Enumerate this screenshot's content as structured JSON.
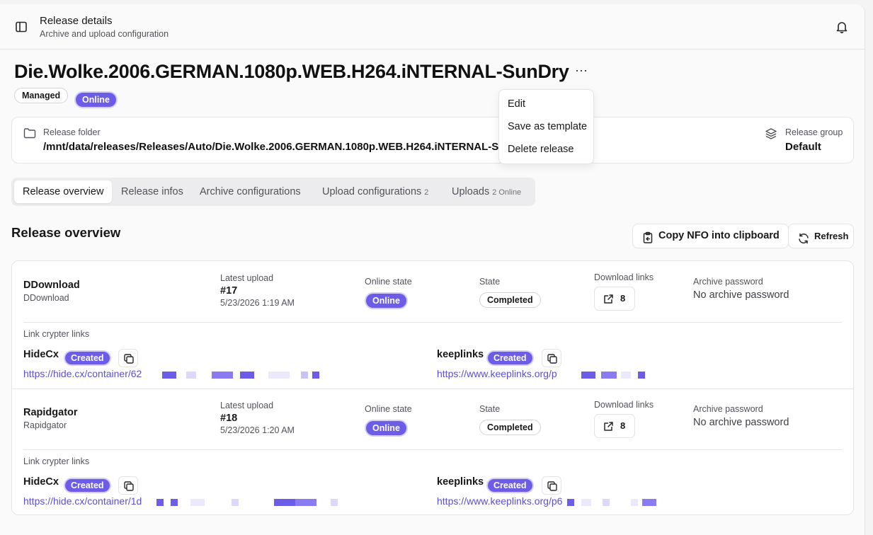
{
  "header": {
    "title": "Release details",
    "subtitle": "Archive and upload configuration"
  },
  "release": {
    "name": "Die.Wolke.2006.GERMAN.1080p.WEB.H264.iNTERNAL-SunDry",
    "badges": {
      "managed": "Managed",
      "online": "Online"
    },
    "folder_label": "Release folder",
    "folder_path": "/mnt/data/releases/Releases/Auto/Die.Wolke.2006.GERMAN.1080p.WEB.H264.iNTERNAL-SunDry",
    "group_label": "Release group",
    "group_value": "Default",
    "more_label": "···"
  },
  "menu": {
    "edit": "Edit",
    "save_template": "Save as template",
    "delete": "Delete release"
  },
  "tabs": [
    {
      "label": "Release overview",
      "count": ""
    },
    {
      "label": "Release infos",
      "count": ""
    },
    {
      "label": "Archive configurations",
      "count": ""
    },
    {
      "label": "Upload configurations",
      "count": "2"
    },
    {
      "label": "Uploads",
      "count": "2 Online"
    }
  ],
  "overview": {
    "title": "Release overview",
    "copy_nfo": "Copy NFO into clipboard",
    "refresh": "Refresh"
  },
  "columns": {
    "latest_upload": "Latest upload",
    "online_state": "Online state",
    "state": "State",
    "download_links": "Download links",
    "archive_password": "Archive password",
    "link_crypter": "Link crypter links"
  },
  "uploads": [
    {
      "hoster": "DDownload",
      "hoster_sub": "DDownload",
      "upload_no": "#17",
      "upload_date": "5/23/2026 1:19 AM",
      "online_state": "Online",
      "state": "Completed",
      "download_count": "8",
      "archive_password": "No archive password",
      "crypters": [
        {
          "name": "HideCx",
          "status": "Created",
          "link": "https://hide.cx/container/62"
        },
        {
          "name": "keeplinks",
          "status": "Created",
          "link": "https://www.keeplinks.org/p"
        }
      ]
    },
    {
      "hoster": "Rapidgator",
      "hoster_sub": "Rapidgator",
      "upload_no": "#18",
      "upload_date": "5/23/2026 1:20 AM",
      "online_state": "Online",
      "state": "Completed",
      "download_count": "8",
      "archive_password": "No archive password",
      "crypters": [
        {
          "name": "HideCx",
          "status": "Created",
          "link": "https://hide.cx/container/1d"
        },
        {
          "name": "keeplinks",
          "status": "Created",
          "link": "https://www.keeplinks.org/p6"
        }
      ]
    }
  ],
  "colors": {
    "accent": "#6d5ce7",
    "link": "#5b4fd6",
    "border": "#e4e4e7"
  },
  "icons": {
    "sidebar_toggle": "sidebar-icon",
    "bell": "bell-icon",
    "folder": "folder-icon",
    "layers": "layers-icon",
    "clipboard": "clipboard-icon",
    "refresh": "refresh-icon",
    "external": "external-link-icon",
    "copy": "copy-icon"
  }
}
